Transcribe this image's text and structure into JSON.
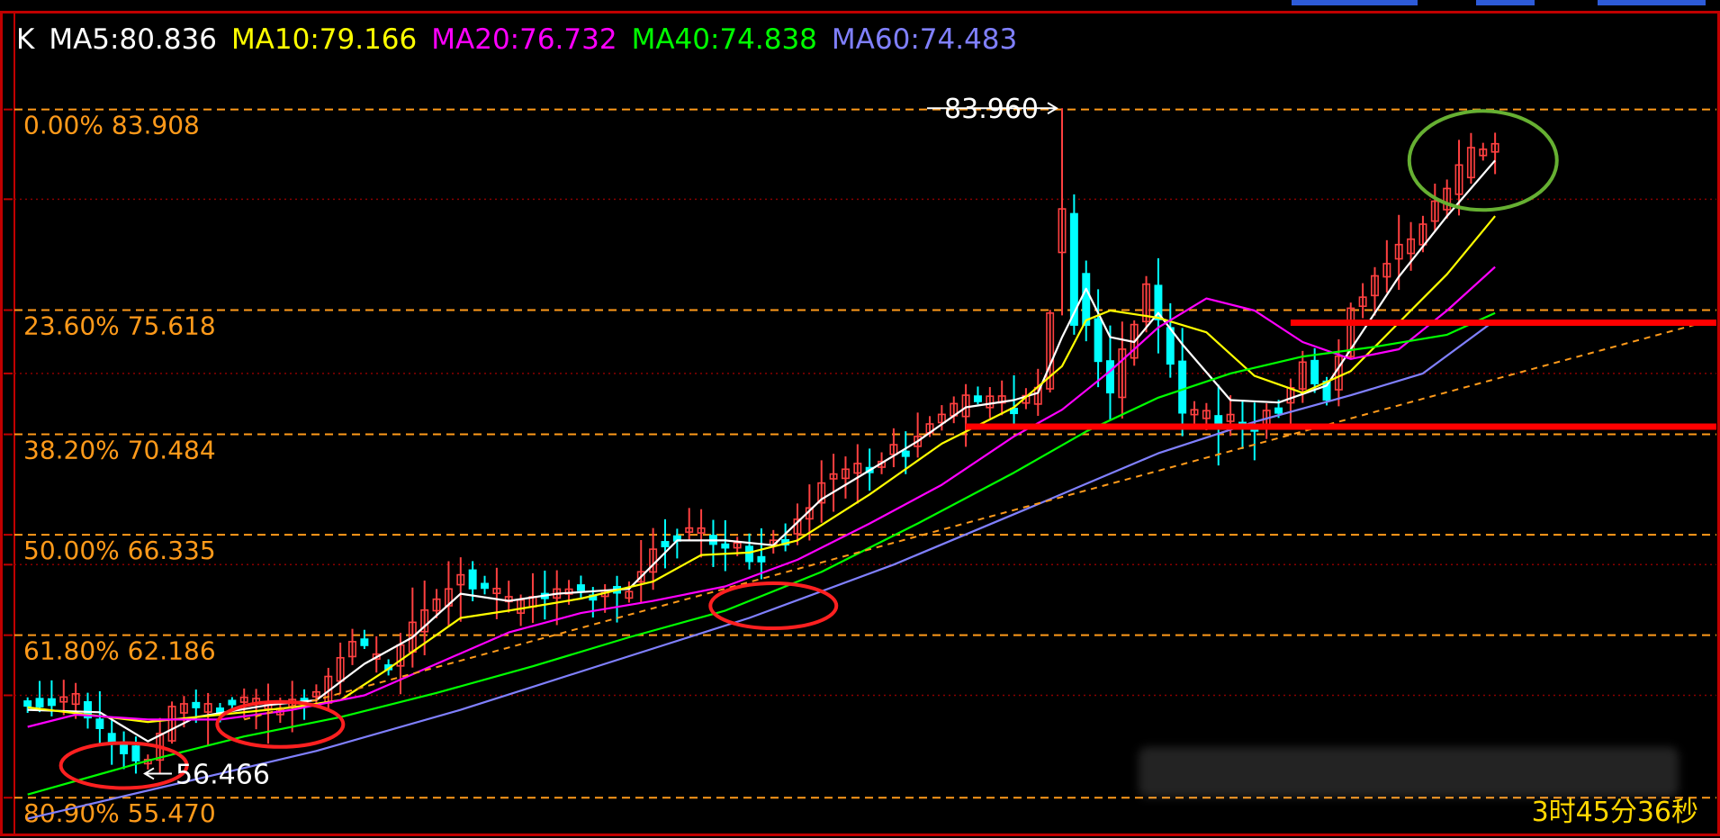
{
  "legend": {
    "k_label": "K",
    "ma5": "MA5:80.836",
    "ma10": "MA10:79.166",
    "ma20": "MA20:76.732",
    "ma40": "MA40:74.838",
    "ma60": "MA60:74.483"
  },
  "timer": "3时45分36秒",
  "colors": {
    "background": "#000000",
    "border": "#c00000",
    "fib": "#ff9a1a",
    "grid": "#8a0000",
    "up": "#ff4040",
    "down": "#00ffff",
    "ma5": "#ffffff",
    "ma10": "#ffff00",
    "ma20": "#ff00ff",
    "ma40": "#00ff00",
    "ma60": "#8080ff",
    "support_line": "#ff0000",
    "highlight_red": "#ff2020",
    "highlight_green": "#66b032"
  },
  "chart_data": {
    "type": "candlestick",
    "ylim": [
      54.4,
      86.2
    ],
    "candle_count": 140,
    "fib_levels": [
      {
        "pct": "0.00%",
        "value": 83.908,
        "label": "0.00% 83.908"
      },
      {
        "pct": "23.60%",
        "value": 75.618,
        "label": "23.60% 75.618"
      },
      {
        "pct": "38.20%",
        "value": 70.484,
        "label": "38.20% 70.484"
      },
      {
        "pct": "50.00%",
        "value": 66.335,
        "label": "50.00% 66.335"
      },
      {
        "pct": "61.80%",
        "value": 62.186,
        "label": "61.80% 62.186"
      },
      {
        "pct": "80.90%",
        "value": 55.47,
        "label": "80.90% 55.470"
      }
    ],
    "grid_values": [
      80.2,
      73.0,
      65.1,
      59.7
    ],
    "annotations": [
      {
        "label": "83.960",
        "value": 83.96,
        "index": 86,
        "kind": "high"
      },
      {
        "label": "56.466",
        "value": 56.466,
        "index": 9,
        "kind": "low"
      }
    ],
    "price_path": [
      [
        0,
        59.3
      ],
      [
        4,
        59.6
      ],
      [
        8,
        57.2
      ],
      [
        10,
        56.9
      ],
      [
        12,
        59.1
      ],
      [
        16,
        59.4
      ],
      [
        20,
        59.2
      ],
      [
        24,
        59.6
      ],
      [
        27,
        61.8
      ],
      [
        30,
        60.8
      ],
      [
        32,
        62.5
      ],
      [
        36,
        64.6
      ],
      [
        38,
        64.2
      ],
      [
        40,
        63.3
      ],
      [
        44,
        64.0
      ],
      [
        48,
        63.9
      ],
      [
        50,
        64.1
      ],
      [
        52,
        65.8
      ],
      [
        55,
        66.6
      ],
      [
        58,
        66.0
      ],
      [
        60,
        65.5
      ],
      [
        63,
        66.2
      ],
      [
        66,
        68.5
      ],
      [
        70,
        69.3
      ],
      [
        74,
        70.3
      ],
      [
        78,
        71.9
      ],
      [
        82,
        71.8
      ],
      [
        84,
        72.2
      ],
      [
        86,
        79.2
      ],
      [
        88,
        75.2
      ],
      [
        90,
        72.2
      ],
      [
        93,
        76.8
      ],
      [
        96,
        71.5
      ],
      [
        99,
        71.1
      ],
      [
        102,
        71.0
      ],
      [
        104,
        71.6
      ],
      [
        106,
        73.6
      ],
      [
        108,
        72.1
      ],
      [
        110,
        75.5
      ],
      [
        113,
        77.6
      ],
      [
        116,
        79.1
      ],
      [
        118,
        80.6
      ],
      [
        120,
        82.1
      ],
      [
        122,
        82.3
      ]
    ],
    "series": [
      {
        "name": "MA5",
        "values": [
          [
            0,
            59.1
          ],
          [
            6,
            59.0
          ],
          [
            10,
            57.8
          ],
          [
            14,
            58.8
          ],
          [
            20,
            59.3
          ],
          [
            24,
            59.5
          ],
          [
            28,
            61.0
          ],
          [
            32,
            62.1
          ],
          [
            36,
            63.9
          ],
          [
            40,
            63.6
          ],
          [
            44,
            63.9
          ],
          [
            50,
            64.1
          ],
          [
            54,
            66.1
          ],
          [
            58,
            66.1
          ],
          [
            62,
            65.9
          ],
          [
            66,
            67.8
          ],
          [
            70,
            69.0
          ],
          [
            74,
            70.2
          ],
          [
            78,
            71.6
          ],
          [
            82,
            71.9
          ],
          [
            84,
            72.2
          ],
          [
            86,
            74.5
          ],
          [
            88,
            76.5
          ],
          [
            90,
            74.5
          ],
          [
            92,
            74.3
          ],
          [
            94,
            75.5
          ],
          [
            96,
            74.2
          ],
          [
            100,
            71.9
          ],
          [
            104,
            71.8
          ],
          [
            108,
            72.5
          ],
          [
            110,
            74.0
          ],
          [
            114,
            77.0
          ],
          [
            118,
            79.5
          ],
          [
            122,
            81.8
          ]
        ]
      },
      {
        "name": "MA10",
        "values": [
          [
            0,
            59.2
          ],
          [
            10,
            58.6
          ],
          [
            16,
            58.9
          ],
          [
            22,
            59.2
          ],
          [
            26,
            59.5
          ],
          [
            30,
            60.8
          ],
          [
            36,
            62.9
          ],
          [
            40,
            63.2
          ],
          [
            46,
            63.7
          ],
          [
            52,
            64.4
          ],
          [
            56,
            65.5
          ],
          [
            60,
            65.6
          ],
          [
            64,
            66.1
          ],
          [
            70,
            68.0
          ],
          [
            76,
            70.1
          ],
          [
            82,
            71.6
          ],
          [
            86,
            73.3
          ],
          [
            88,
            75.2
          ],
          [
            90,
            75.6
          ],
          [
            94,
            75.3
          ],
          [
            98,
            74.7
          ],
          [
            102,
            72.9
          ],
          [
            106,
            72.2
          ],
          [
            110,
            73.1
          ],
          [
            114,
            75.1
          ],
          [
            118,
            77.1
          ],
          [
            122,
            79.5
          ]
        ]
      },
      {
        "name": "MA20",
        "values": [
          [
            0,
            58.4
          ],
          [
            4,
            58.9
          ],
          [
            10,
            58.7
          ],
          [
            16,
            58.7
          ],
          [
            22,
            59.1
          ],
          [
            28,
            59.7
          ],
          [
            34,
            61.0
          ],
          [
            40,
            62.3
          ],
          [
            46,
            63.1
          ],
          [
            52,
            63.6
          ],
          [
            58,
            64.2
          ],
          [
            64,
            65.3
          ],
          [
            70,
            66.8
          ],
          [
            76,
            68.4
          ],
          [
            82,
            70.4
          ],
          [
            86,
            71.5
          ],
          [
            90,
            73.1
          ],
          [
            94,
            74.9
          ],
          [
            98,
            76.1
          ],
          [
            102,
            75.6
          ],
          [
            106,
            74.3
          ],
          [
            110,
            73.6
          ],
          [
            114,
            74.0
          ],
          [
            118,
            75.6
          ],
          [
            122,
            77.4
          ]
        ]
      },
      {
        "name": "MA40",
        "values": [
          [
            0,
            55.6
          ],
          [
            10,
            57.0
          ],
          [
            18,
            58.0
          ],
          [
            26,
            58.8
          ],
          [
            34,
            59.8
          ],
          [
            42,
            60.9
          ],
          [
            50,
            62.1
          ],
          [
            58,
            63.2
          ],
          [
            66,
            64.8
          ],
          [
            74,
            66.8
          ],
          [
            82,
            68.9
          ],
          [
            88,
            70.6
          ],
          [
            94,
            72.0
          ],
          [
            100,
            73.0
          ],
          [
            106,
            73.7
          ],
          [
            112,
            74.1
          ],
          [
            118,
            74.6
          ],
          [
            122,
            75.5
          ]
        ]
      },
      {
        "name": "MA60",
        "values": [
          [
            0,
            54.6
          ],
          [
            12,
            56.0
          ],
          [
            24,
            57.4
          ],
          [
            36,
            59.1
          ],
          [
            48,
            61.0
          ],
          [
            60,
            62.9
          ],
          [
            72,
            65.1
          ],
          [
            84,
            67.6
          ],
          [
            94,
            69.7
          ],
          [
            102,
            71.0
          ],
          [
            110,
            72.1
          ],
          [
            116,
            73.0
          ],
          [
            122,
            75.2
          ]
        ]
      }
    ],
    "trendlines": [
      {
        "from": [
          18,
          58.7
        ],
        "to": [
          140,
          75.2
        ],
        "style": "dashed"
      }
    ],
    "support_lines": [
      {
        "value": 70.8,
        "from_index": 78,
        "to_index": 140
      },
      {
        "value": 75.1,
        "from_index": 105,
        "to_index": 140
      }
    ],
    "highlights": [
      {
        "kind": "ellipse",
        "index": 8,
        "value": 56.8,
        "color": "red"
      },
      {
        "kind": "ellipse",
        "index": 21,
        "value": 58.5,
        "color": "red"
      },
      {
        "kind": "ellipse",
        "index": 62,
        "value": 63.4,
        "color": "red"
      },
      {
        "kind": "ellipse",
        "index": 121,
        "value": 81.8,
        "color": "green"
      }
    ]
  }
}
